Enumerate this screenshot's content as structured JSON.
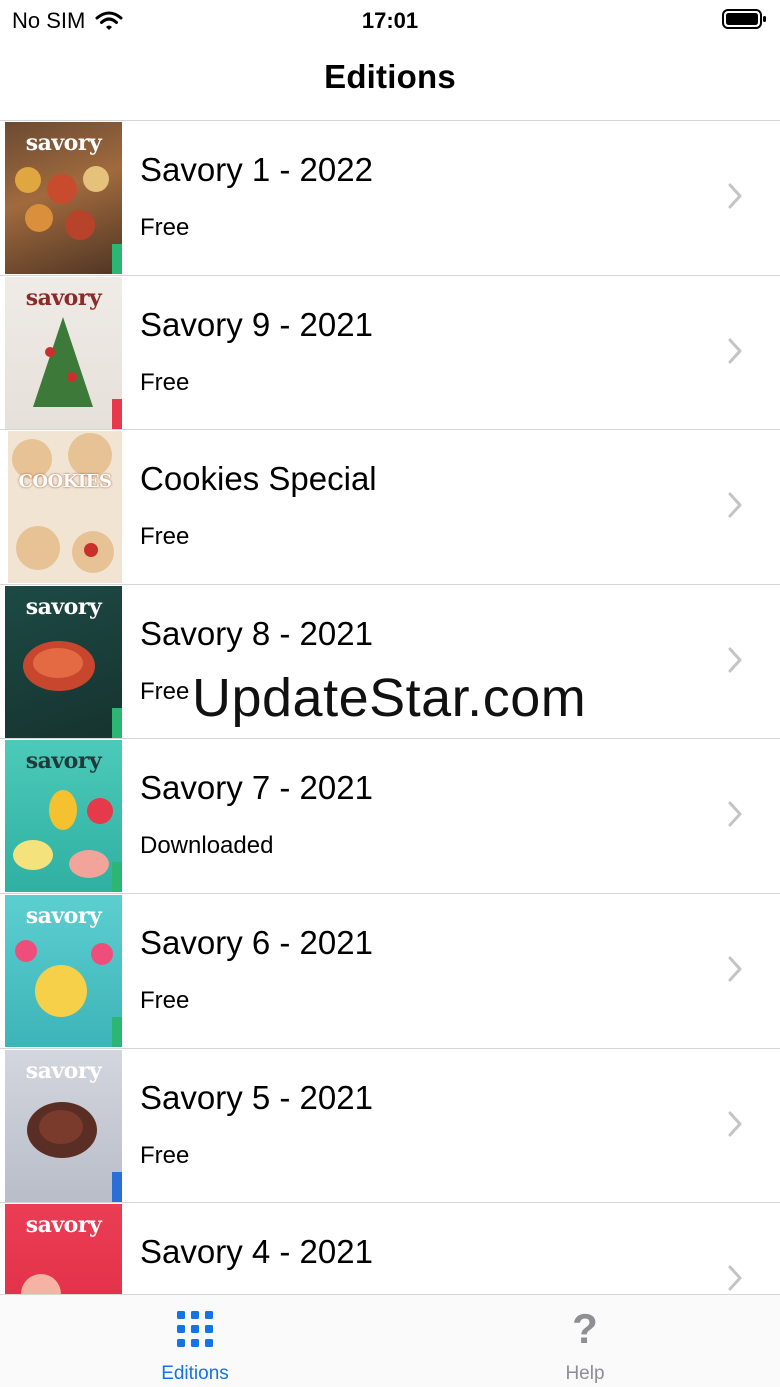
{
  "status_bar": {
    "carrier": "No SIM",
    "time": "17:01"
  },
  "nav": {
    "title": "Editions"
  },
  "editions": [
    {
      "title": "Savory 1 - 2022",
      "status": "Free",
      "cover_mast": "savory",
      "cover_color": "#8a5a3a"
    },
    {
      "title": "Savory 9 - 2021",
      "status": "Free",
      "cover_mast": "savory",
      "cover_color": "#e9e4df"
    },
    {
      "title": "Cookies Special",
      "status": "Free",
      "cover_mast": "COOKIES",
      "cover_color": "#e8d2b8"
    },
    {
      "title": "Savory 8 - 2021",
      "status": "Free",
      "cover_mast": "savory",
      "cover_color": "#1f4a44"
    },
    {
      "title": "Savory 7 - 2021",
      "status": "Downloaded",
      "cover_mast": "savory",
      "cover_color": "#3fc2b5"
    },
    {
      "title": "Savory 6 - 2021",
      "status": "Free",
      "cover_mast": "savory",
      "cover_color": "#4ec6c8"
    },
    {
      "title": "Savory 5 - 2021",
      "status": "Free",
      "cover_mast": "savory",
      "cover_color": "#c9cdd6"
    },
    {
      "title": "Savory 4 - 2021",
      "status": "",
      "cover_mast": "savory",
      "cover_color": "#e8394c"
    }
  ],
  "watermark": "UpdateStar.com",
  "tab_bar": {
    "editions_label": "Editions",
    "help_label": "Help",
    "help_glyph": "?"
  },
  "colors": {
    "accent": "#1473e6",
    "separator": "#d6d6d8",
    "inactive": "#8e8e93"
  }
}
